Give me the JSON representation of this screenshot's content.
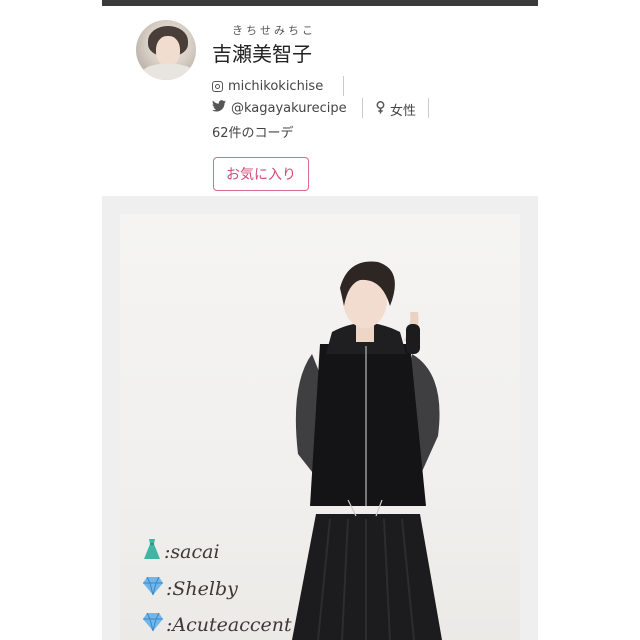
{
  "profile": {
    "furigana": "きちせみちこ",
    "name": "吉瀬美智子",
    "instagram": "michikokichise",
    "twitter": "@kagayakurecipe",
    "gender": "女性",
    "coord_count": "62件のコーデ",
    "favorite_button": "お気に入り"
  },
  "photo": {
    "captions": [
      {
        "icon": "dress-icon",
        "text": ":sacai"
      },
      {
        "icon": "gem-icon",
        "text": ":Shelby"
      },
      {
        "icon": "gem-icon",
        "text": ":Acuteaccent"
      }
    ]
  },
  "colors": {
    "accent": "#d14b78",
    "topbar": "#3a3a3a",
    "background_gray": "#efefef"
  }
}
